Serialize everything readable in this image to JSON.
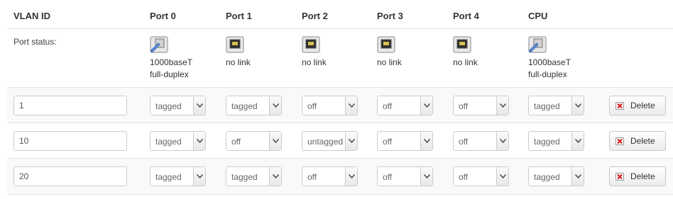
{
  "headers": {
    "vlan_id": "VLAN ID",
    "ports": [
      "Port 0",
      "Port 1",
      "Port 2",
      "Port 3",
      "Port 4",
      "CPU"
    ]
  },
  "status_row": {
    "label": "Port status:",
    "ports": [
      {
        "line1": "1000baseT",
        "line2": "full-duplex",
        "icon": "port-connected-icon"
      },
      {
        "line1": "no link",
        "line2": "",
        "icon": "port-nolink-icon"
      },
      {
        "line1": "no link",
        "line2": "",
        "icon": "port-nolink-icon"
      },
      {
        "line1": "no link",
        "line2": "",
        "icon": "port-nolink-icon"
      },
      {
        "line1": "no link",
        "line2": "",
        "icon": "port-nolink-icon"
      },
      {
        "line1": "1000baseT",
        "line2": "full-duplex",
        "icon": "port-connected-icon"
      }
    ]
  },
  "vlans": [
    {
      "id": "1",
      "ports": [
        "tagged",
        "tagged",
        "off",
        "off",
        "off",
        "tagged"
      ],
      "delete_label": "Delete"
    },
    {
      "id": "10",
      "ports": [
        "tagged",
        "off",
        "untagged",
        "off",
        "off",
        "tagged"
      ],
      "delete_label": "Delete"
    },
    {
      "id": "20",
      "ports": [
        "tagged",
        "tagged",
        "off",
        "off",
        "off",
        "tagged"
      ],
      "delete_label": "Delete"
    }
  ]
}
